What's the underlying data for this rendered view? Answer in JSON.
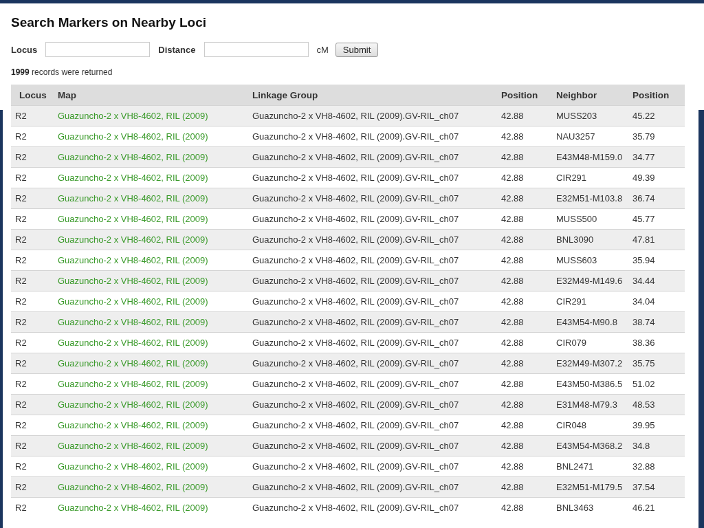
{
  "title": "Search Markers on Nearby Loci",
  "form": {
    "locus_label": "Locus",
    "distance_label": "Distance",
    "unit": "cM",
    "submit": "Submit"
  },
  "summary": {
    "count": "1999",
    "text": "records were returned"
  },
  "table": {
    "columns": [
      "Locus",
      "Map",
      "Linkage Group",
      "Position",
      "Neighbor",
      "Position"
    ],
    "rows": [
      [
        "R2",
        "Guazuncho-2 x VH8-4602, RIL (2009)",
        "Guazuncho-2 x VH8-4602, RIL (2009).GV-RIL_ch07",
        "42.88",
        "MUSS203",
        "45.22"
      ],
      [
        "R2",
        "Guazuncho-2 x VH8-4602, RIL (2009)",
        "Guazuncho-2 x VH8-4602, RIL (2009).GV-RIL_ch07",
        "42.88",
        "NAU3257",
        "35.79"
      ],
      [
        "R2",
        "Guazuncho-2 x VH8-4602, RIL (2009)",
        "Guazuncho-2 x VH8-4602, RIL (2009).GV-RIL_ch07",
        "42.88",
        "E43M48-M159.0",
        "34.77"
      ],
      [
        "R2",
        "Guazuncho-2 x VH8-4602, RIL (2009)",
        "Guazuncho-2 x VH8-4602, RIL (2009).GV-RIL_ch07",
        "42.88",
        "CIR291",
        "49.39"
      ],
      [
        "R2",
        "Guazuncho-2 x VH8-4602, RIL (2009)",
        "Guazuncho-2 x VH8-4602, RIL (2009).GV-RIL_ch07",
        "42.88",
        "E32M51-M103.8",
        "36.74"
      ],
      [
        "R2",
        "Guazuncho-2 x VH8-4602, RIL (2009)",
        "Guazuncho-2 x VH8-4602, RIL (2009).GV-RIL_ch07",
        "42.88",
        "MUSS500",
        "45.77"
      ],
      [
        "R2",
        "Guazuncho-2 x VH8-4602, RIL (2009)",
        "Guazuncho-2 x VH8-4602, RIL (2009).GV-RIL_ch07",
        "42.88",
        "BNL3090",
        "47.81"
      ],
      [
        "R2",
        "Guazuncho-2 x VH8-4602, RIL (2009)",
        "Guazuncho-2 x VH8-4602, RIL (2009).GV-RIL_ch07",
        "42.88",
        "MUSS603",
        "35.94"
      ],
      [
        "R2",
        "Guazuncho-2 x VH8-4602, RIL (2009)",
        "Guazuncho-2 x VH8-4602, RIL (2009).GV-RIL_ch07",
        "42.88",
        "E32M49-M149.6",
        "34.44"
      ],
      [
        "R2",
        "Guazuncho-2 x VH8-4602, RIL (2009)",
        "Guazuncho-2 x VH8-4602, RIL (2009).GV-RIL_ch07",
        "42.88",
        "CIR291",
        "34.04"
      ],
      [
        "R2",
        "Guazuncho-2 x VH8-4602, RIL (2009)",
        "Guazuncho-2 x VH8-4602, RIL (2009).GV-RIL_ch07",
        "42.88",
        "E43M54-M90.8",
        "38.74"
      ],
      [
        "R2",
        "Guazuncho-2 x VH8-4602, RIL (2009)",
        "Guazuncho-2 x VH8-4602, RIL (2009).GV-RIL_ch07",
        "42.88",
        "CIR079",
        "38.36"
      ],
      [
        "R2",
        "Guazuncho-2 x VH8-4602, RIL (2009)",
        "Guazuncho-2 x VH8-4602, RIL (2009).GV-RIL_ch07",
        "42.88",
        "E32M49-M307.2",
        "35.75"
      ],
      [
        "R2",
        "Guazuncho-2 x VH8-4602, RIL (2009)",
        "Guazuncho-2 x VH8-4602, RIL (2009).GV-RIL_ch07",
        "42.88",
        "E43M50-M386.5",
        "51.02"
      ],
      [
        "R2",
        "Guazuncho-2 x VH8-4602, RIL (2009)",
        "Guazuncho-2 x VH8-4602, RIL (2009).GV-RIL_ch07",
        "42.88",
        "E31M48-M79.3",
        "48.53"
      ],
      [
        "R2",
        "Guazuncho-2 x VH8-4602, RIL (2009)",
        "Guazuncho-2 x VH8-4602, RIL (2009).GV-RIL_ch07",
        "42.88",
        "CIR048",
        "39.95"
      ],
      [
        "R2",
        "Guazuncho-2 x VH8-4602, RIL (2009)",
        "Guazuncho-2 x VH8-4602, RIL (2009).GV-RIL_ch07",
        "42.88",
        "E43M54-M368.2",
        "34.8"
      ],
      [
        "R2",
        "Guazuncho-2 x VH8-4602, RIL (2009)",
        "Guazuncho-2 x VH8-4602, RIL (2009).GV-RIL_ch07",
        "42.88",
        "BNL2471",
        "32.88"
      ],
      [
        "R2",
        "Guazuncho-2 x VH8-4602, RIL (2009)",
        "Guazuncho-2 x VH8-4602, RIL (2009).GV-RIL_ch07",
        "42.88",
        "E32M51-M179.5",
        "37.54"
      ],
      [
        "R2",
        "Guazuncho-2 x VH8-4602, RIL (2009)",
        "Guazuncho-2 x VH8-4602, RIL (2009).GV-RIL_ch07",
        "42.88",
        "BNL3463",
        "46.21"
      ]
    ]
  }
}
